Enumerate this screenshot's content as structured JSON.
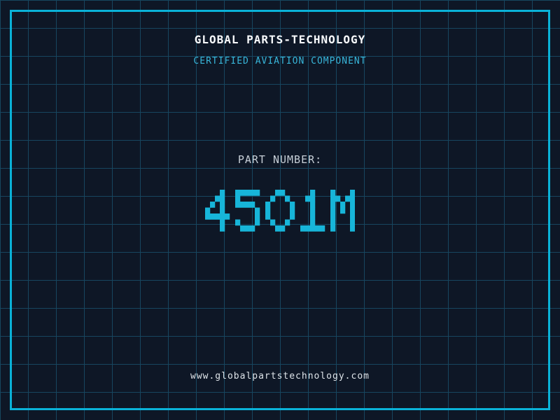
{
  "header": {
    "title": "GLOBAL PARTS-TECHNOLOGY",
    "subtitle": "CERTIFIED AVIATION COMPONENT"
  },
  "part": {
    "label": "PART NUMBER:",
    "value": "4501M"
  },
  "footer": {
    "website": "www.globalpartstechnology.com"
  },
  "colors": {
    "background": "#0e1726",
    "grid_line": "#17465f",
    "frame": "#0ab2d8",
    "title": "#f8fafc",
    "subtitle": "#38b6da",
    "part_label": "#c6ced6",
    "part_value": "#17b5d9",
    "footer": "#dde3e8"
  }
}
